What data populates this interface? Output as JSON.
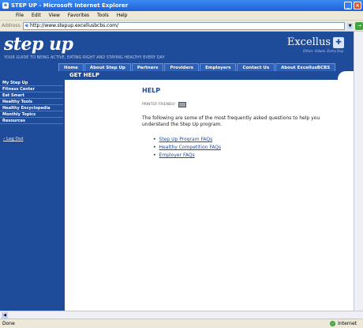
{
  "browser": {
    "title": "STEP UP - Microsoft Internet Explorer",
    "menu": [
      "File",
      "Edit",
      "View",
      "Favorites",
      "Tools",
      "Help"
    ],
    "address_label": "Address",
    "url": "http://www.stepup.excellusbcbs.com/",
    "status_text": "Done",
    "zone_text": "Internet"
  },
  "site": {
    "logo": "step up",
    "tagline": "YOUR GUIDE TO BEING ACTIVE, EATING RIGHT AND STAYING HEALTHY EVERY DAY",
    "brand": "Excellus",
    "brand_tagline": "Ethics. Values. Every Day.",
    "nav": [
      "Home",
      "About Step Up",
      "Partners",
      "Providers",
      "Employers",
      "Contact Us",
      "About ExcellusBCBS"
    ],
    "page_header": "GET HELP"
  },
  "sidebar": {
    "items": [
      "My Step Up",
      "Fitness Center",
      "Eat Smart",
      "Healthy Tools",
      "Healthy Encyclopedia",
      "Monthly Topics",
      "Resources"
    ],
    "logout": "Log Out"
  },
  "main": {
    "title": "HELP",
    "printer_label": "PRINTER FRIENDLY",
    "intro": "The following are some of the most frequently asked questions to help you understand the Step Up program.",
    "faqs": [
      "Step Up Program FAQs",
      "Healthy Competition FAQs",
      "Employer FAQs"
    ]
  }
}
